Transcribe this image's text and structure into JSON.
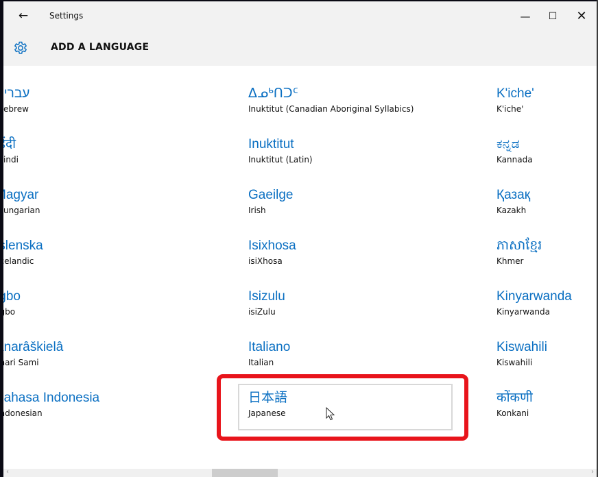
{
  "window": {
    "title": "Settings",
    "back_glyph": "←",
    "minimize_glyph": "—",
    "maximize_glyph": "☐",
    "close_glyph": "✕"
  },
  "header": {
    "title": "ADD A LANGUAGE",
    "icon": "gear-icon"
  },
  "languages": {
    "col0": [
      {
        "native": "עברית",
        "english": "Hebrew"
      },
      {
        "native": "हिंदी",
        "english": "Hindi"
      },
      {
        "native": "Magyar",
        "english": "Hungarian"
      },
      {
        "native": "íslenska",
        "english": "Icelandic"
      },
      {
        "native": "Igbo",
        "english": "Igbo"
      },
      {
        "native": "Anarâškielâ",
        "english": "Inari Sami"
      },
      {
        "native": "Bahasa Indonesia",
        "english": "Indonesian"
      }
    ],
    "col1": [
      {
        "native": "ᐃᓄᒃᑎᑐᑦ",
        "english": "Inuktitut (Canadian Aboriginal Syllabics)"
      },
      {
        "native": "Inuktitut",
        "english": "Inuktitut (Latin)"
      },
      {
        "native": "Gaeilge",
        "english": "Irish"
      },
      {
        "native": "Isixhosa",
        "english": "isiXhosa"
      },
      {
        "native": "Isizulu",
        "english": "isiZulu"
      },
      {
        "native": "Italiano",
        "english": "Italian"
      },
      {
        "native": "日本語",
        "english": "Japanese"
      }
    ],
    "col2": [
      {
        "native": "K'iche'",
        "english": "K'iche'"
      },
      {
        "native": "ಕನ್ನಡ",
        "english": "Kannada"
      },
      {
        "native": "Қазақ",
        "english": "Kazakh"
      },
      {
        "native": "ភាសាខ្មែរ",
        "english": "Khmer"
      },
      {
        "native": "Kinyarwanda",
        "english": "Kinyarwanda"
      },
      {
        "native": "Kiswahili",
        "english": "Kiswahili"
      },
      {
        "native": "कोंकणी",
        "english": "Konkani"
      }
    ]
  },
  "colors": {
    "accent": "#0a6fc2",
    "highlight": "#e8141b",
    "chrome": "#f2f2f2"
  },
  "scrollbar": {
    "left_glyph": "‹",
    "right_glyph": "›"
  }
}
